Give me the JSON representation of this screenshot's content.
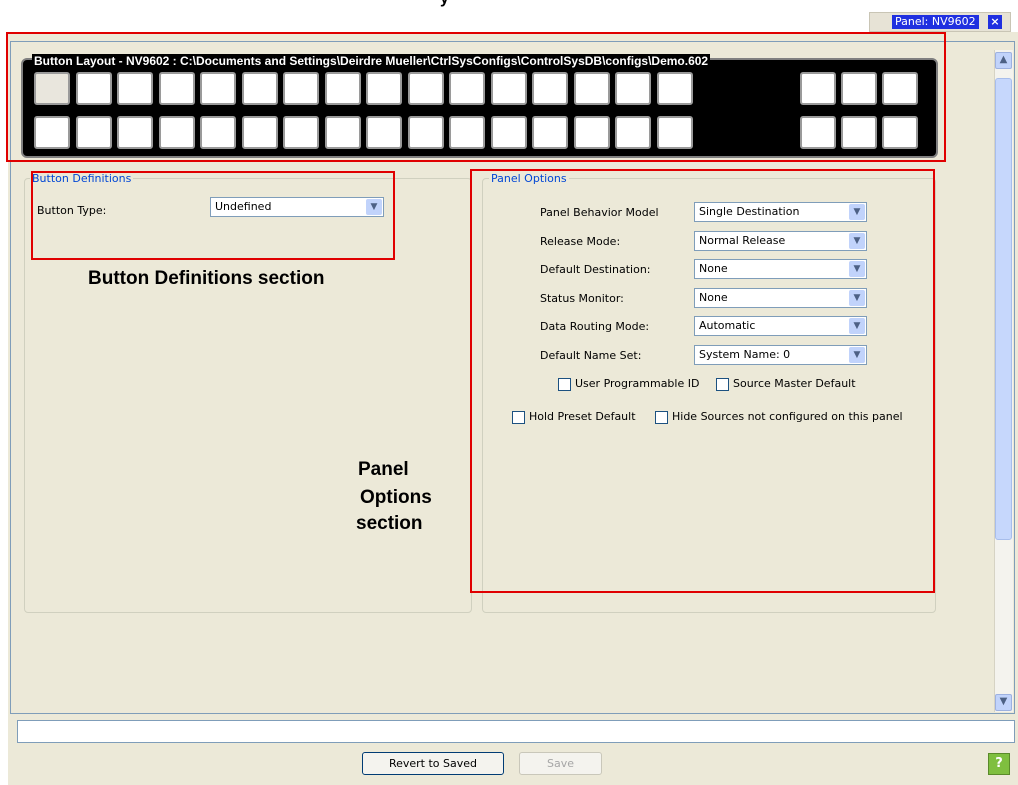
{
  "header": {
    "layout_fragment": "y",
    "panel_tab": {
      "label": "Panel: NV9602",
      "close": "×"
    }
  },
  "button_layout": {
    "title": "Button Layout - NV9602 : C:\\Documents and Settings\\Deirdre Mueller\\CtrlSysConfigs\\ControlSysDB\\configs\\Demo.602",
    "rows": 2,
    "main_buttons_per_row": 16,
    "side_buttons_per_row": 3
  },
  "button_definitions": {
    "title": "Button Definitions",
    "button_type_label": "Button Type:",
    "button_type_value": "Undefined"
  },
  "panel_options": {
    "title": "Panel Options",
    "fields": [
      {
        "label": "Panel Behavior Model",
        "value": "Single Destination"
      },
      {
        "label": "Release Mode:",
        "value": "Normal Release"
      },
      {
        "label": "Default Destination:",
        "value": "None"
      },
      {
        "label": "Status Monitor:",
        "value": "None"
      },
      {
        "label": "Data Routing Mode:",
        "value": "Automatic"
      },
      {
        "label": "Default Name Set:",
        "value": "System Name: 0"
      }
    ],
    "checkboxes": [
      {
        "label": "User Programmable ID",
        "checked": false
      },
      {
        "label": "Source Master Default",
        "checked": false
      },
      {
        "label": "Hold Preset Default",
        "checked": false
      },
      {
        "label": "Hide Sources not configured on this panel",
        "checked": false
      }
    ]
  },
  "annotations": {
    "button_definitions_note": "Button Definitions section",
    "panel_options_note_1": "Panel",
    "panel_options_note_2": "Options",
    "panel_options_note_3": "section"
  },
  "footer": {
    "revert_label": "Revert to Saved",
    "save_label": "Save",
    "help_icon": "?"
  },
  "colors": {
    "annotation": "#e00000",
    "group_title": "#0046d5",
    "tab_highlight": "#2030e0"
  }
}
